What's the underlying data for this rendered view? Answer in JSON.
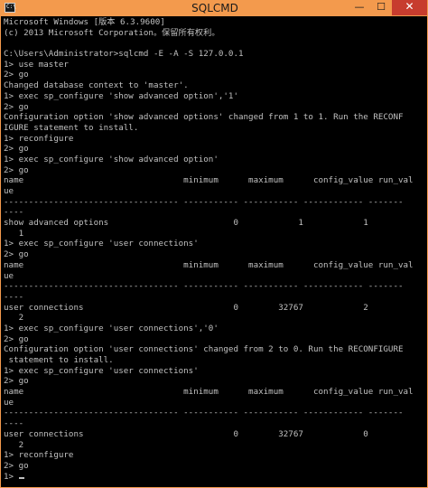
{
  "window": {
    "title": "SQLCMD",
    "icon_name": "console-icon",
    "icon_glyph": "C:\\",
    "buttons": {
      "minimize": "—",
      "maximize": "☐",
      "close": "✕"
    },
    "colors": {
      "frame": "#f39a4d",
      "close": "#c73c2e",
      "text": "#c0c0c0",
      "background": "#000000"
    }
  },
  "console": {
    "lines": [
      "Microsoft Windows [版本 6.3.9600]",
      "(c) 2013 Microsoft Corporation。保留所有权利。",
      "",
      "C:\\Users\\Administrator>sqlcmd -E -A -S 127.0.0.1",
      "1> use master",
      "2> go",
      "Changed database context to 'master'.",
      "1> exec sp_configure 'show advanced option','1'",
      "2> go",
      "Configuration option 'show advanced options' changed from 1 to 1. Run the RECONF",
      "IGURE statement to install.",
      "1> reconfigure",
      "2> go",
      "1> exec sp_configure 'show advanced option'",
      "2> go",
      "name                                minimum      maximum      config_value run_val",
      "ue",
      "----------------------------------- ----------- ----------- ------------ -------",
      "----",
      "show advanced options                         0            1            1",
      "   1",
      "1> exec sp_configure 'user connections'",
      "2> go",
      "name                                minimum      maximum      config_value run_val",
      "ue",
      "----------------------------------- ----------- ----------- ------------ -------",
      "----",
      "user connections                              0        32767            2",
      "   2",
      "1> exec sp_configure 'user connections','0'",
      "2> go",
      "Configuration option 'user connections' changed from 2 to 0. Run the RECONFIGURE",
      " statement to install.",
      "1> exec sp_configure 'user connections'",
      "2> go",
      "name                                minimum      maximum      config_value run_val",
      "ue",
      "----------------------------------- ----------- ----------- ------------ -------",
      "----",
      "user connections                              0        32767            0",
      "   2",
      "1> reconfigure",
      "2> go"
    ],
    "prompt": "1> "
  }
}
